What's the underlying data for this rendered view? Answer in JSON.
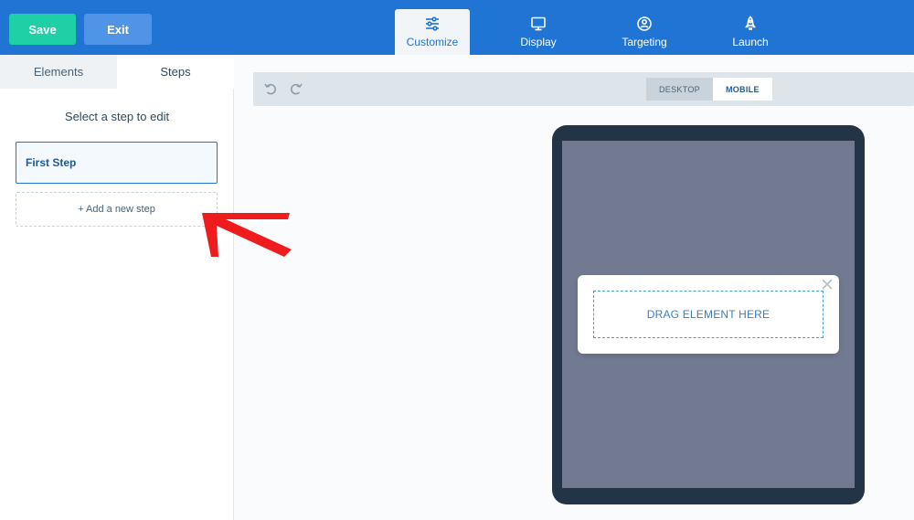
{
  "header": {
    "save_label": "Save",
    "exit_label": "Exit",
    "tabs": [
      {
        "label": "Customize",
        "icon": "sliders-icon",
        "active": true
      },
      {
        "label": "Display",
        "icon": "monitor-icon",
        "active": false
      },
      {
        "label": "Targeting",
        "icon": "user-circle-icon",
        "active": false
      },
      {
        "label": "Launch",
        "icon": "rocket-icon",
        "active": false
      }
    ]
  },
  "sidebar": {
    "tabs": [
      {
        "label": "Elements",
        "active": false
      },
      {
        "label": "Steps",
        "active": true
      }
    ],
    "title": "Select a step to edit",
    "steps": [
      {
        "label": "First Step",
        "selected": true
      }
    ],
    "add_step_label": "+ Add a new step"
  },
  "toolbar": {
    "undo_icon": "undo-icon",
    "redo_icon": "redo-icon",
    "device_options": [
      {
        "label": "DESKTOP",
        "active": false
      },
      {
        "label": "MOBILE",
        "active": true
      }
    ]
  },
  "canvas": {
    "drop_zone_text": "DRAG ELEMENT HERE",
    "close_icon": "close-icon"
  },
  "colors": {
    "header_bg": "#1f74d4",
    "save_button": "#1fcfa5",
    "exit_button": "#4f94e6",
    "annotation_arrow": "#ee1c1c",
    "phone_frame": "#243447",
    "phone_screen": "#727a92"
  }
}
